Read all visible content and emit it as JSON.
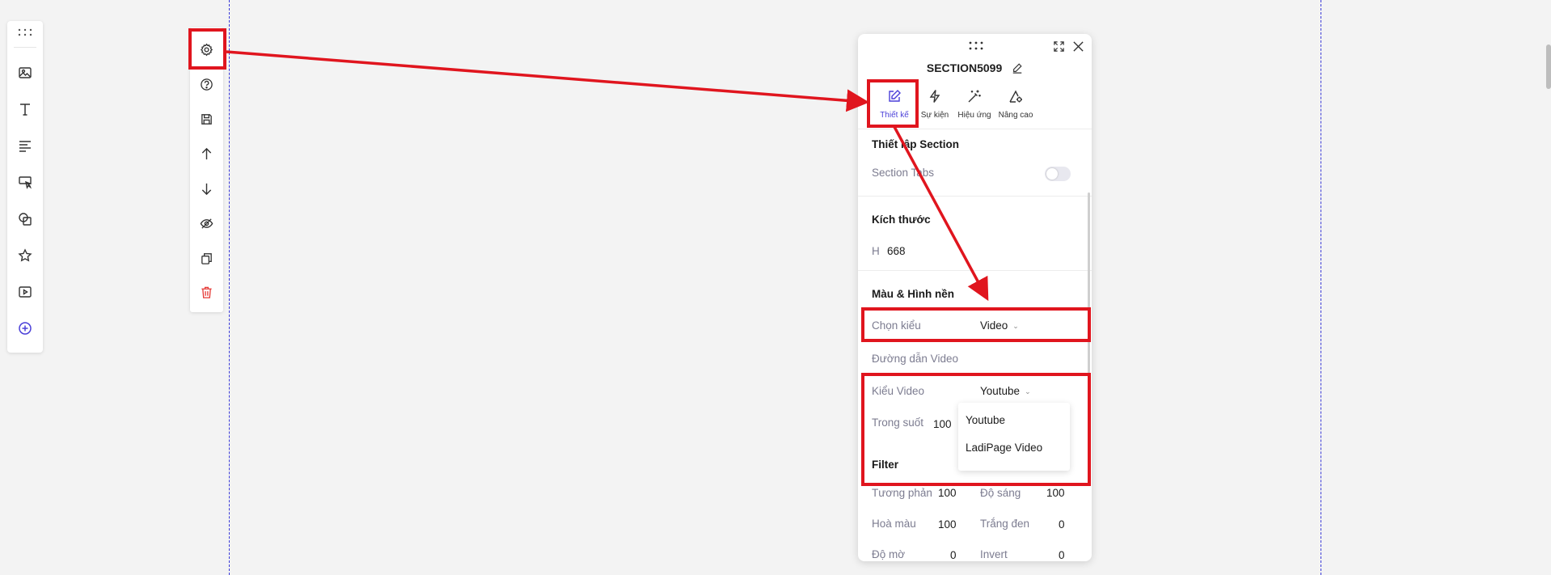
{
  "panel": {
    "section_name": "SECTION5099",
    "tabs": [
      {
        "label": "Thiết kế",
        "icon": "edit-icon",
        "active": true
      },
      {
        "label": "Sự kiện",
        "icon": "lightning-icon",
        "active": false
      },
      {
        "label": "Hiệu ứng",
        "icon": "magic-wand-icon",
        "active": false
      },
      {
        "label": "Nâng cao",
        "icon": "advanced-settings-icon",
        "active": false
      }
    ],
    "section_settings": {
      "heading": "Thiết lập Section",
      "section_tabs_label": "Section Tabs",
      "section_tabs_enabled": false
    },
    "size": {
      "heading": "Kích thước",
      "h_label": "H",
      "h_value": "668"
    },
    "background": {
      "heading": "Màu & Hình nền",
      "type_label": "Chọn kiểu",
      "type_value": "Video",
      "video_path_label": "Đường dẫn Video",
      "video_type_label": "Kiểu Video",
      "video_type_value": "Youtube",
      "opacity_label": "Trong suốt",
      "opacity_value": "100",
      "video_type_options": [
        "Youtube",
        "LadiPage Video"
      ]
    },
    "filter": {
      "heading": "Filter",
      "contrast_label": "Tương phản",
      "contrast_value": "100",
      "brightness_label": "Độ sáng",
      "brightness_value": "100",
      "saturate_label": "Hoà màu",
      "saturate_value": "100",
      "grayscale_label": "Trắng đen",
      "grayscale_value": "0",
      "blur_label": "Độ mờ",
      "blur_value": "0",
      "invert_label": "Invert",
      "invert_value": "0"
    }
  },
  "left_toolbar": [
    "drag-handle-icon",
    "image-icon",
    "text-icon",
    "paragraph-icon",
    "button-icon",
    "shape-icon",
    "star-icon",
    "video-icon",
    "add-icon"
  ],
  "section_toolbar": [
    "gear-icon",
    "help-icon",
    "save-icon",
    "arrow-up-icon",
    "arrow-down-icon",
    "hide-icon",
    "duplicate-icon",
    "trash-icon"
  ],
  "colors": {
    "accent": "#4a3fd8",
    "annotation": "#e0151e",
    "guide": "#3a3ad8",
    "danger": "#e53935"
  }
}
